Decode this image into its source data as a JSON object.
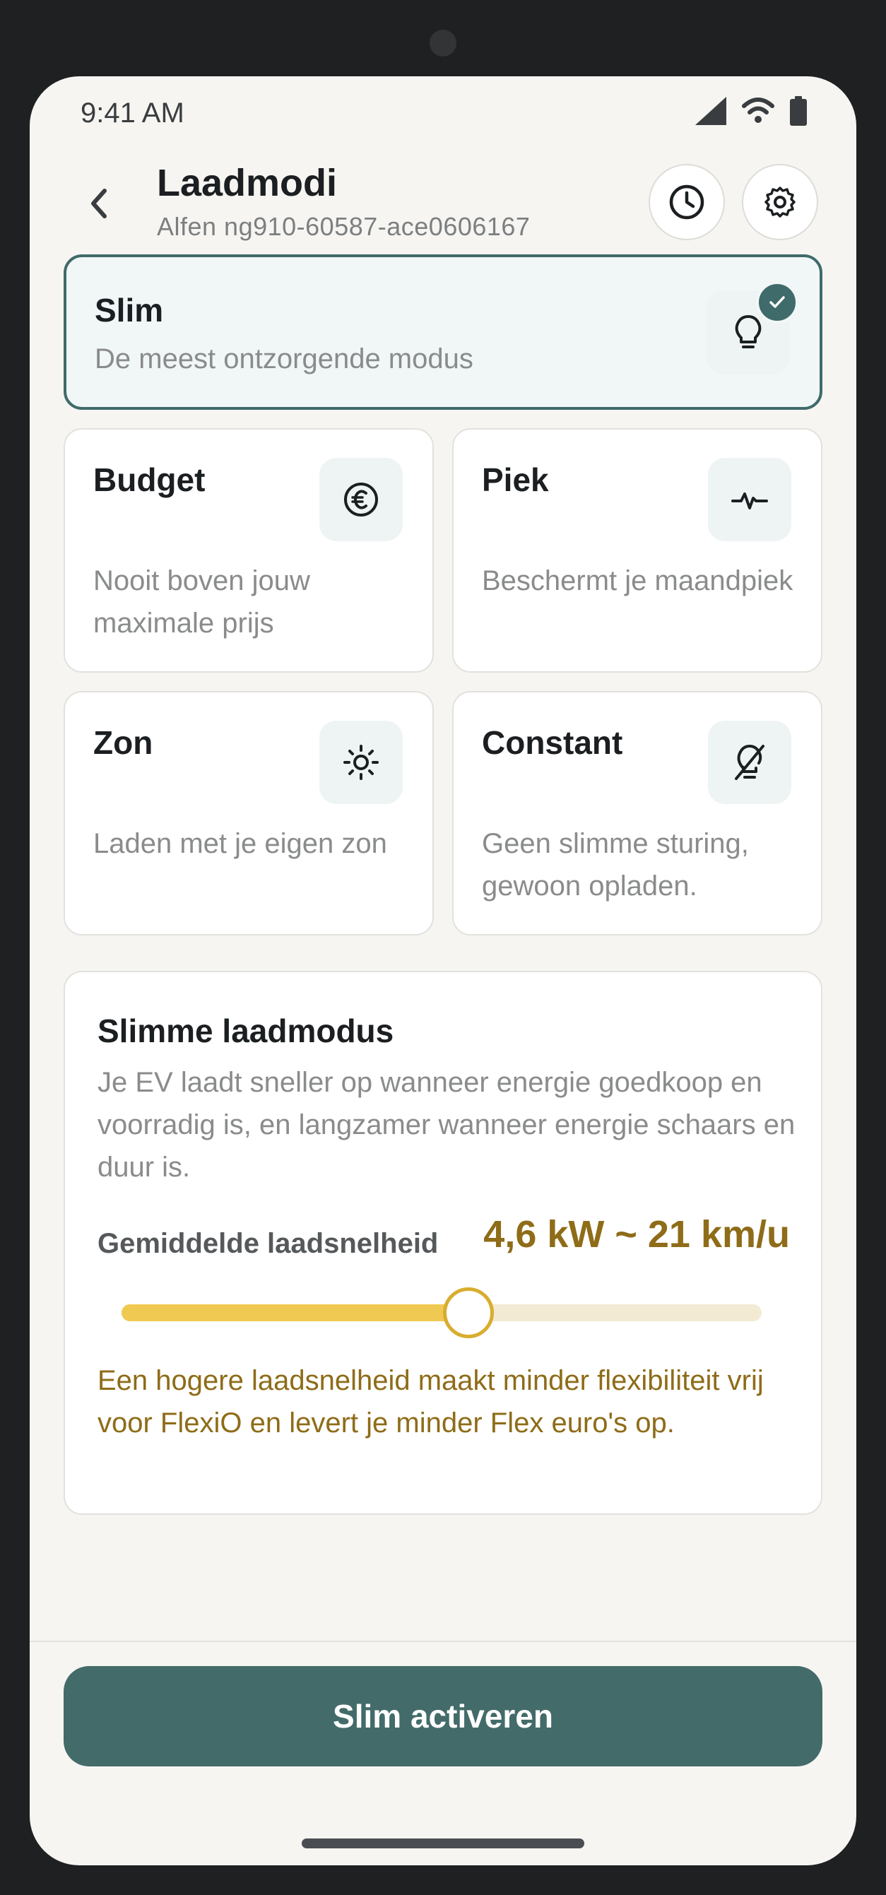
{
  "status_bar": {
    "time": "9:41 AM"
  },
  "header": {
    "title": "Laadmodi",
    "subtitle": "Alfen ng910-60587-ace0606167"
  },
  "modes": [
    {
      "id": "slim",
      "title": "Slim",
      "description": "De meest ontzorgende modus",
      "icon": "lightbulb-icon",
      "selected": true
    },
    {
      "id": "budget",
      "title": "Budget",
      "description": "Nooit boven jouw maximale prijs",
      "icon": "euro-icon",
      "selected": false
    },
    {
      "id": "piek",
      "title": "Piek",
      "description": "Beschermt je maandpiek",
      "icon": "pulse-icon",
      "selected": false
    },
    {
      "id": "zon",
      "title": "Zon",
      "description": "Laden met je eigen zon",
      "icon": "sun-icon",
      "selected": false
    },
    {
      "id": "constant",
      "title": "Constant",
      "description": "Geen slimme sturing, gewoon opladen.",
      "icon": "bulb-off-icon",
      "selected": false
    }
  ],
  "info": {
    "title": "Slimme laadmodus",
    "description": "Je EV laadt sneller op wanneer energie goedkoop en voorradig is, en langzamer wanneer energie schaars en duur is.",
    "speed_label": "Gemiddelde laadsnelheid",
    "speed_value": "4,6 kW ~ 21 km/u",
    "slider_fraction": 0.54,
    "warning": "Een hogere laadsnelheid maakt minder flexibiliteit vrij voor FlexiO en levert je minder Flex euro's op."
  },
  "cta": {
    "label": "Slim activeren"
  },
  "colors": {
    "accent": "#436b69",
    "warning_text": "#8e6c18",
    "slider_fill": "#f0c952"
  }
}
